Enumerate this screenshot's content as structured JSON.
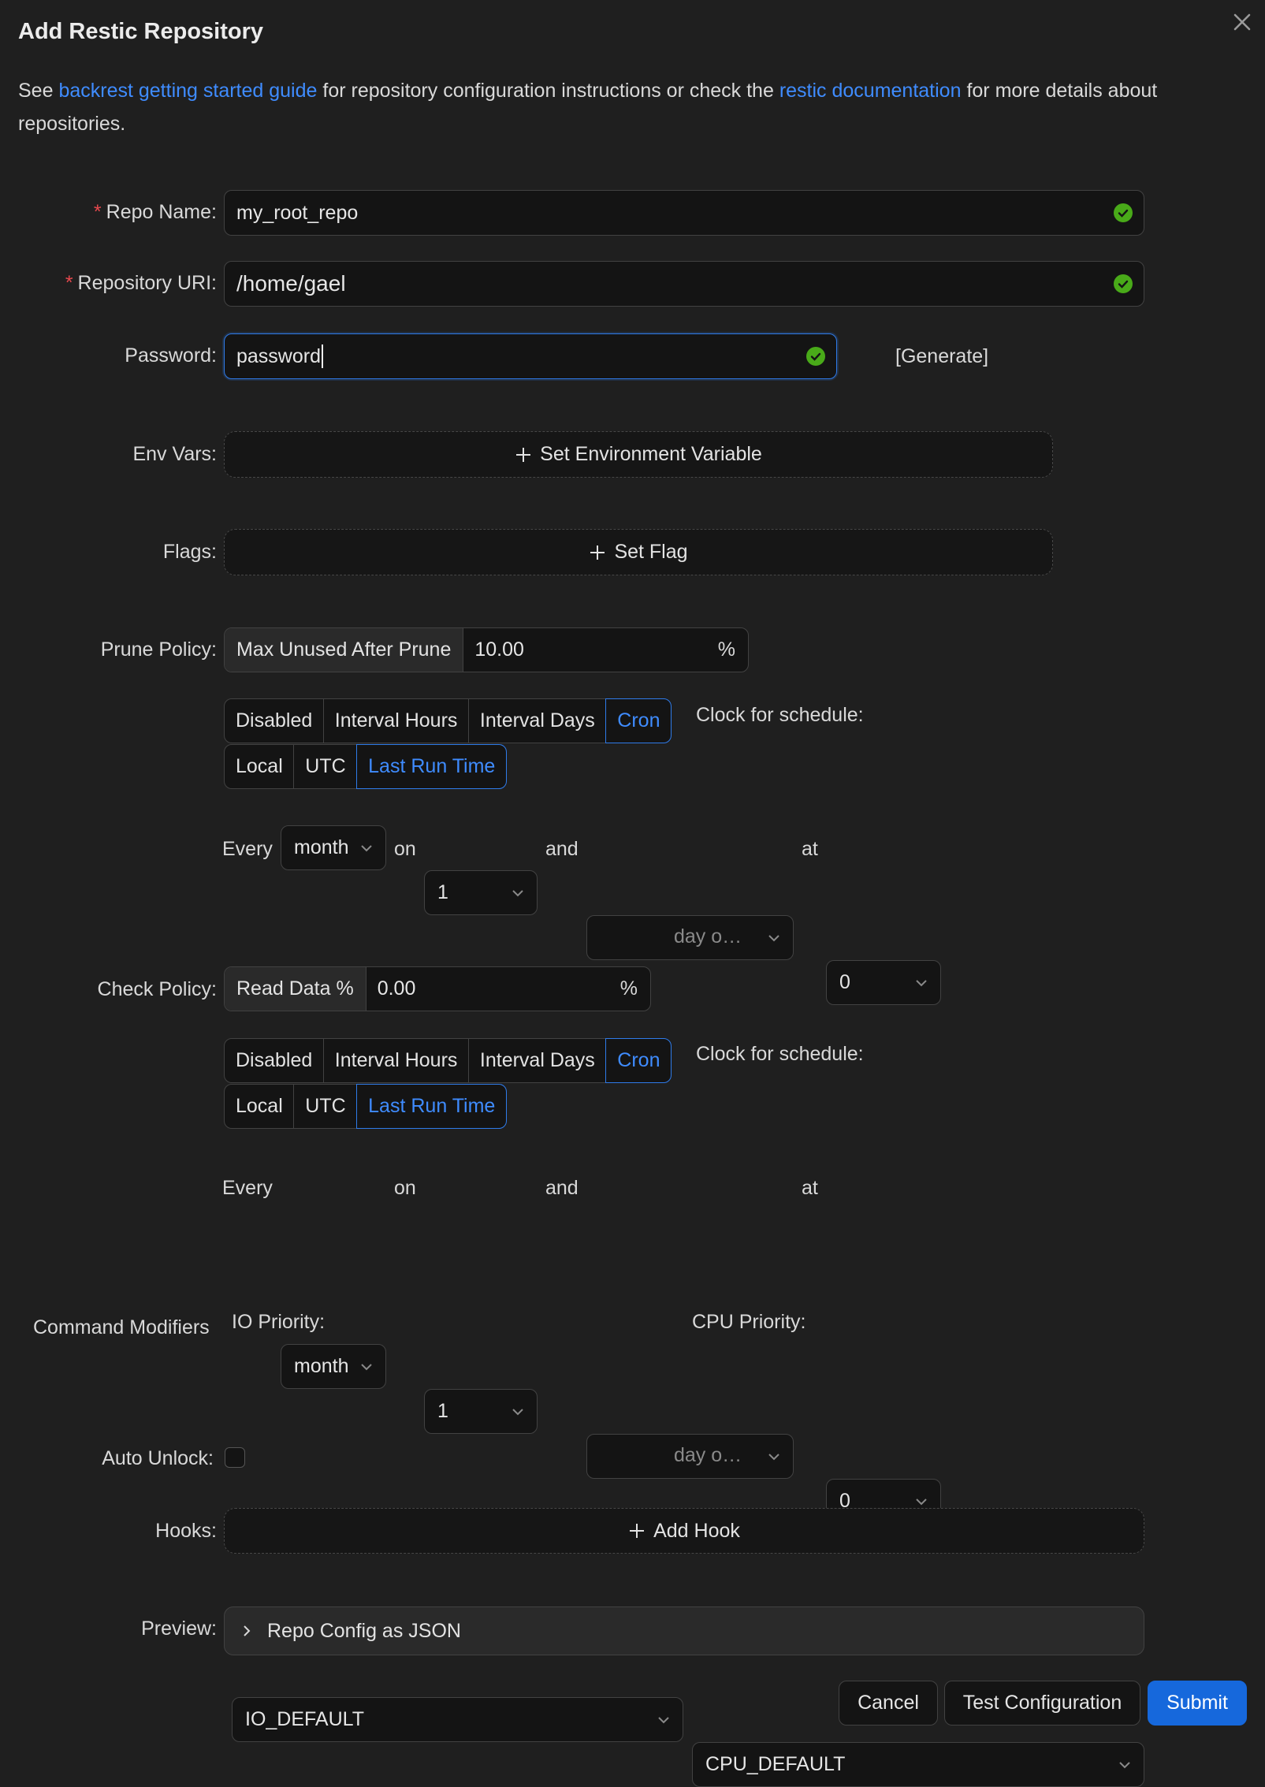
{
  "dialog": {
    "title": "Add Restic Repository",
    "intro": {
      "prefix": "See ",
      "link1": "backrest getting started guide",
      "middle": " for repository configuration instructions or check the ",
      "link2": "restic documentation",
      "suffix": " for more details about repositories."
    }
  },
  "form": {
    "repo_name": {
      "label": "Repo Name",
      "value": "my_root_repo"
    },
    "repo_uri": {
      "label": "Repository URI",
      "value": "/home/gael"
    },
    "password": {
      "label": "Password",
      "value": "password",
      "generate_label": "[Generate]"
    },
    "env_vars": {
      "label": "Env Vars",
      "button_label": "Set Environment Variable"
    },
    "flags": {
      "label": "Flags",
      "button_label": "Set Flag"
    },
    "prune_policy": {
      "label": "Prune Policy",
      "addon_prefix": "Max Unused After Prune",
      "value": "10.00",
      "suffix": "%",
      "schedule_modes": [
        "Disabled",
        "Interval Hours",
        "Interval Days",
        "Cron"
      ],
      "selected_mode": "Cron",
      "clock_label": "Clock for schedule:",
      "clock_modes": [
        "Local",
        "UTC",
        "Last Run Time"
      ],
      "selected_clock": "Last Run Time",
      "cron": {
        "every": "Every",
        "period": "month",
        "on": "on",
        "day": "1",
        "and": "and",
        "weekday_placeholder": "day o…",
        "at": "at",
        "hour": "0"
      }
    },
    "check_policy": {
      "label": "Check Policy",
      "addon_prefix": "Read Data %",
      "value": "0.00",
      "suffix": "%",
      "schedule_modes": [
        "Disabled",
        "Interval Hours",
        "Interval Days",
        "Cron"
      ],
      "selected_mode": "Cron",
      "clock_label": "Clock for schedule:",
      "clock_modes": [
        "Local",
        "UTC",
        "Last Run Time"
      ],
      "selected_clock": "Last Run Time",
      "cron": {
        "every": "Every",
        "period": "month",
        "on": "on",
        "day": "1",
        "and": "and",
        "weekday_placeholder": "day o…",
        "at": "at",
        "hour": "0"
      }
    },
    "command_modifiers": {
      "label": "Command Modifiers",
      "io_label": "IO Priority:",
      "io_value": "IO_DEFAULT",
      "cpu_label": "CPU Priority:",
      "cpu_value": "CPU_DEFAULT"
    },
    "auto_unlock": {
      "label": "Auto Unlock",
      "checked": false
    },
    "hooks": {
      "label": "Hooks",
      "button_label": "Add Hook"
    },
    "preview": {
      "label": "Preview",
      "panel_label": "Repo Config as JSON"
    }
  },
  "footer": {
    "cancel": "Cancel",
    "test": "Test Configuration",
    "submit": "Submit"
  },
  "colors": {
    "background": "#1f1f1f",
    "accent": "#1668dc",
    "link": "#3f8cff",
    "valid": "#49aa19",
    "required": "#e5484d"
  }
}
